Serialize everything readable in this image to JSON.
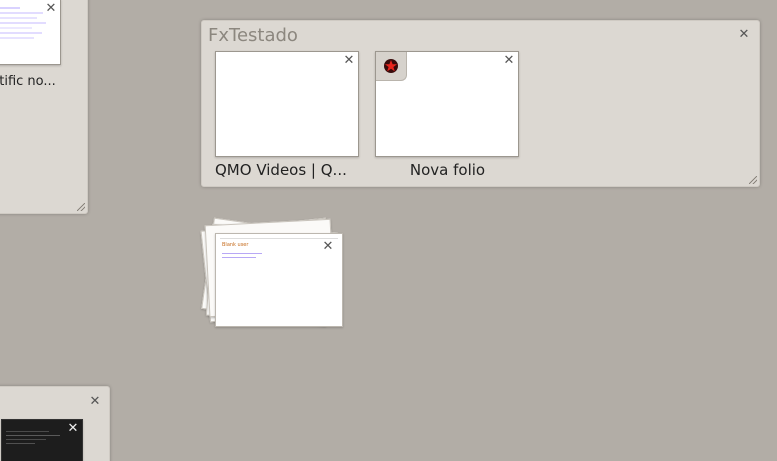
{
  "groups": [
    {
      "name": "left-top-group",
      "title": "",
      "tabs": [
        {
          "title": "ntific no..."
        }
      ]
    },
    {
      "name": "fxtestado-group",
      "title": "FxTestado",
      "tabs": [
        {
          "title": "QMO Videos | Q...",
          "favicon": ""
        },
        {
          "title": "Nova folio",
          "favicon": "red-star-icon"
        }
      ]
    },
    {
      "name": "left-bottom-group",
      "title": "",
      "tabs": []
    }
  ],
  "stack": {
    "preview_title": "Blank user",
    "count_hint": "stacked tabs"
  },
  "icons": {
    "close": "close-icon",
    "resize": "resize-grip-icon"
  },
  "colors": {
    "background": "#b2ada6",
    "group_bg": "#dedad4",
    "title_text": "#8c877f",
    "link": "#5a3fd6"
  }
}
